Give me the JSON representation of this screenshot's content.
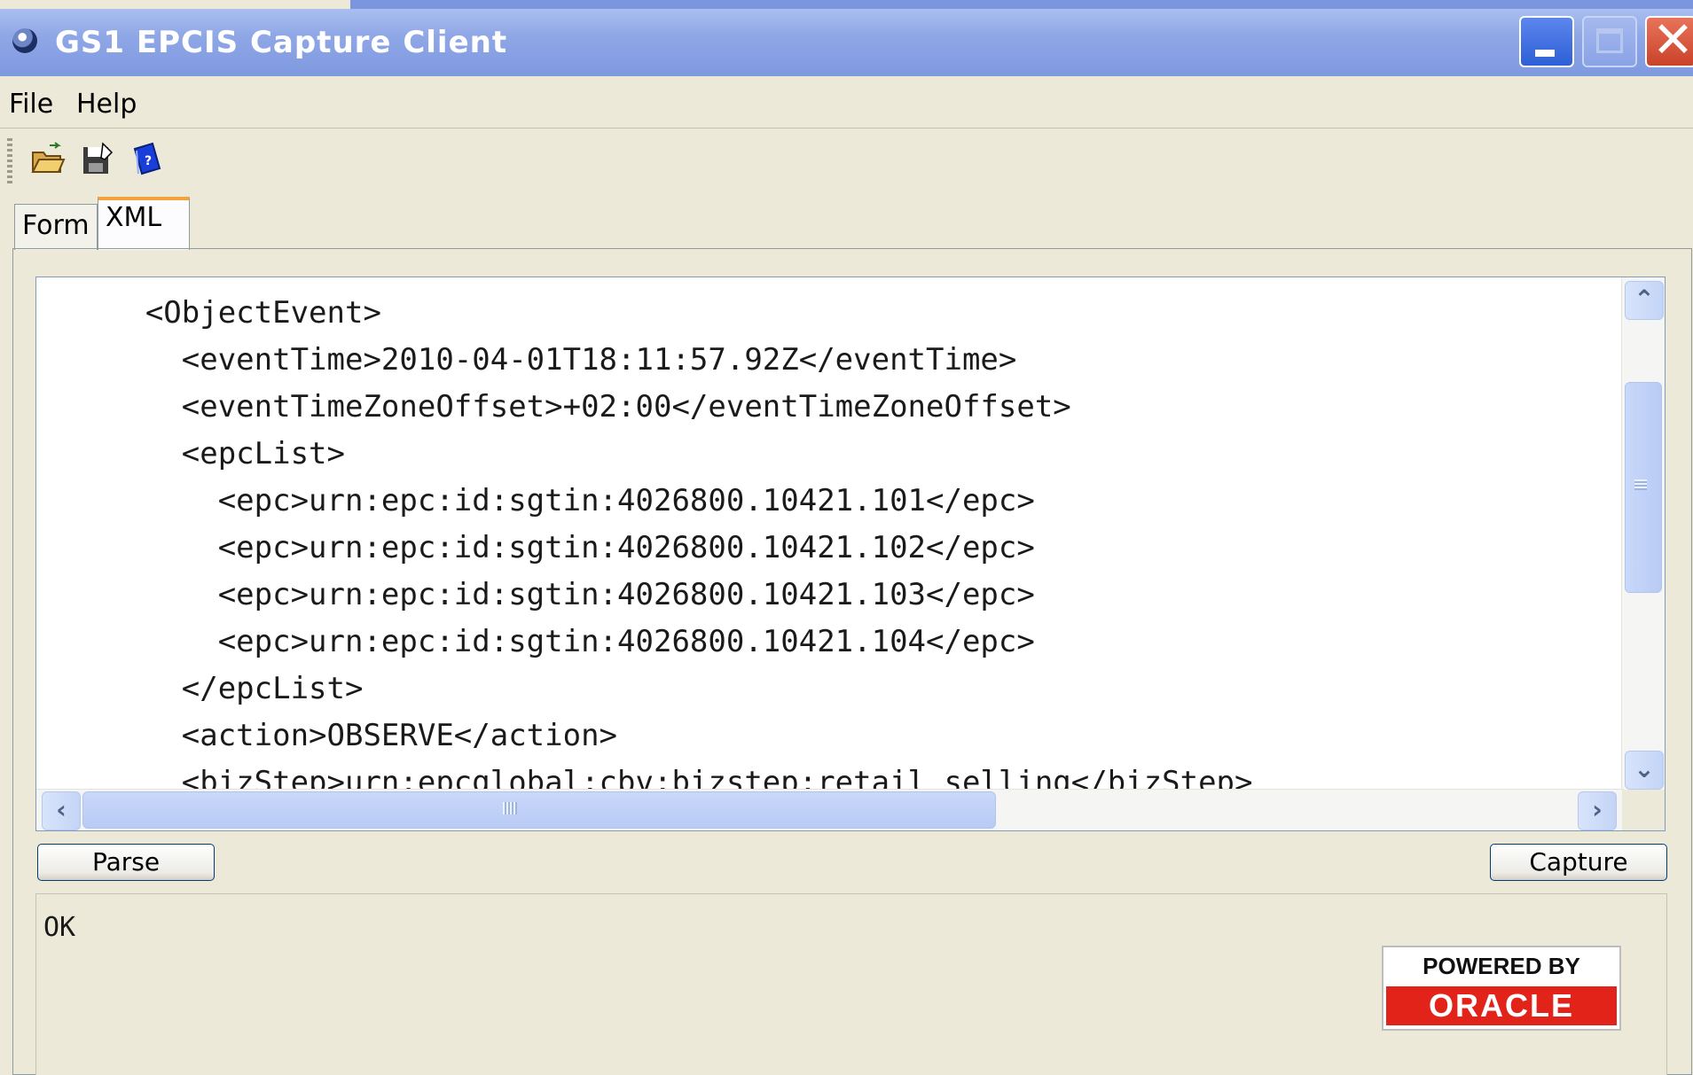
{
  "window": {
    "title": "GS1 EPCIS Capture Client"
  },
  "menu": {
    "items": [
      "File",
      "Help"
    ]
  },
  "toolbar": {
    "icons": [
      "open-folder-icon",
      "save-icon",
      "help-book-icon"
    ]
  },
  "tabs": [
    {
      "label": "Form",
      "selected": false
    },
    {
      "label": "XML",
      "selected": true
    }
  ],
  "editor": {
    "lines": [
      "      <ObjectEvent>",
      "        <eventTime>2010-04-01T18:11:57.92Z</eventTime>",
      "        <eventTimeZoneOffset>+02:00</eventTimeZoneOffset>",
      "        <epcList>",
      "          <epc>urn:epc:id:sgtin:4026800.10421.101</epc>",
      "          <epc>urn:epc:id:sgtin:4026800.10421.102</epc>",
      "          <epc>urn:epc:id:sgtin:4026800.10421.103</epc>",
      "          <epc>urn:epc:id:sgtin:4026800.10421.104</epc>",
      "        </epcList>",
      "        <action>OBSERVE</action>",
      "        <bizStep>urn:epcglobal:cbv:bizstep:retail_selling</bizStep>"
    ]
  },
  "buttons": {
    "parse": "Parse",
    "capture": "Capture"
  },
  "status": {
    "text": "OK"
  },
  "badge": {
    "top": "POWERED BY",
    "brand": "ORACLE"
  },
  "colors": {
    "titlebar": "#8fa7e6",
    "tab_highlight": "#f2a33e",
    "oracle_red": "#e2231a"
  }
}
